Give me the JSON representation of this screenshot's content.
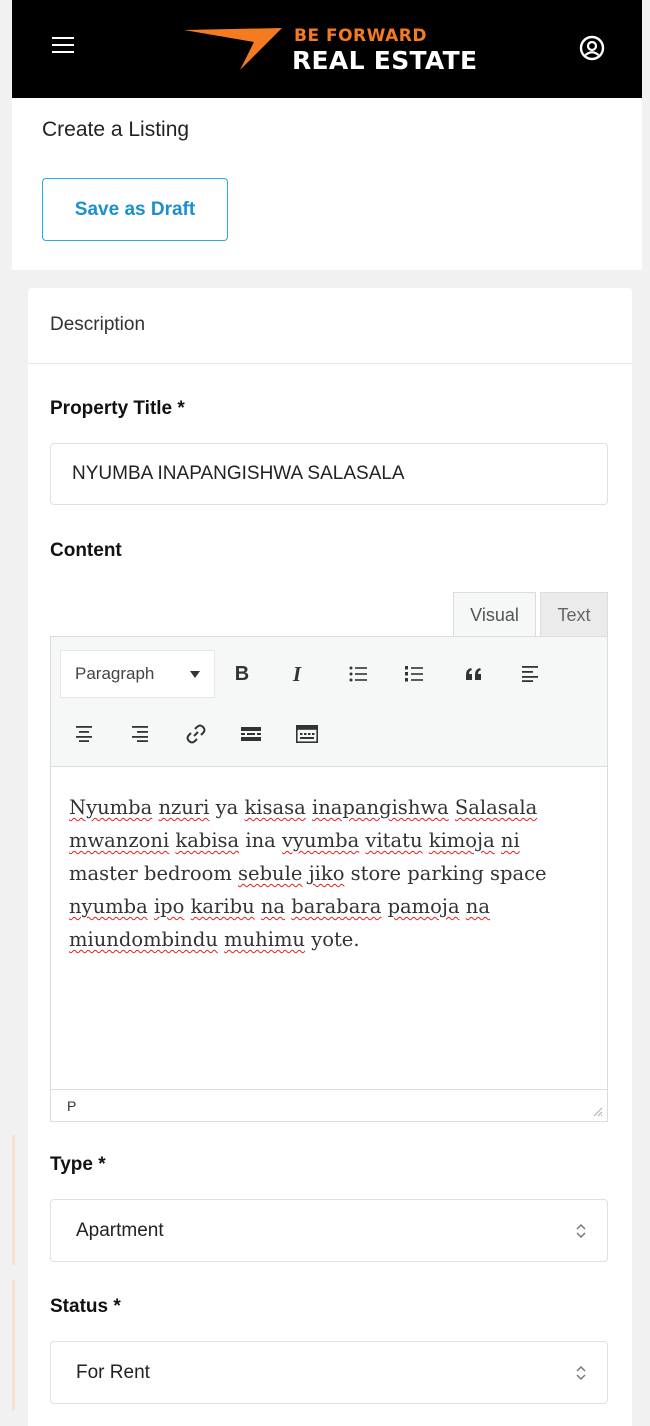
{
  "header": {
    "logo_line1": "BE FORWARD",
    "logo_line2": "REAL ESTATE",
    "brand_color": "#f47b20",
    "menu_icon": "hamburger-icon",
    "account_icon": "user-circle-icon"
  },
  "page": {
    "title": "Create a Listing",
    "save_draft_label": "Save as Draft"
  },
  "card": {
    "title": "Description"
  },
  "form": {
    "property_title_label": "Property Title *",
    "property_title_value": "NYUMBA INAPANGISHWA SALASALA",
    "content_label": "Content",
    "type_label": "Type *",
    "type_value": "Apartment",
    "status_label": "Status *",
    "status_value": "For Rent"
  },
  "editor": {
    "tabs": [
      "Visual",
      "Text"
    ],
    "active_tab": "Visual",
    "format_value": "Paragraph",
    "toolbar_icons": [
      "bold-icon",
      "italic-icon",
      "bullet-list-icon",
      "numbered-list-icon",
      "blockquote-icon",
      "align-left-icon",
      "align-center-icon",
      "align-right-icon",
      "link-icon",
      "read-more-icon",
      "toolbar-toggle-icon"
    ],
    "bold_glyph": "B",
    "italic_glyph": "I",
    "quote_glyph": "66",
    "content_words": [
      "Nyumba",
      "nzuri",
      "ya",
      "kisasa",
      "inapangishwa",
      "Salasala",
      "mwanzoni",
      "kabisa",
      "ina",
      "vyumba",
      "vitatu",
      "kimoja",
      "ni",
      "master bedroom",
      "sebule",
      "jiko",
      "store parking space",
      "nyumba",
      "ipo",
      "karibu",
      "na",
      "barabara",
      "pamoja",
      "na",
      "miundombindu",
      "muhimu",
      "yote."
    ],
    "path_indicator": "P"
  }
}
